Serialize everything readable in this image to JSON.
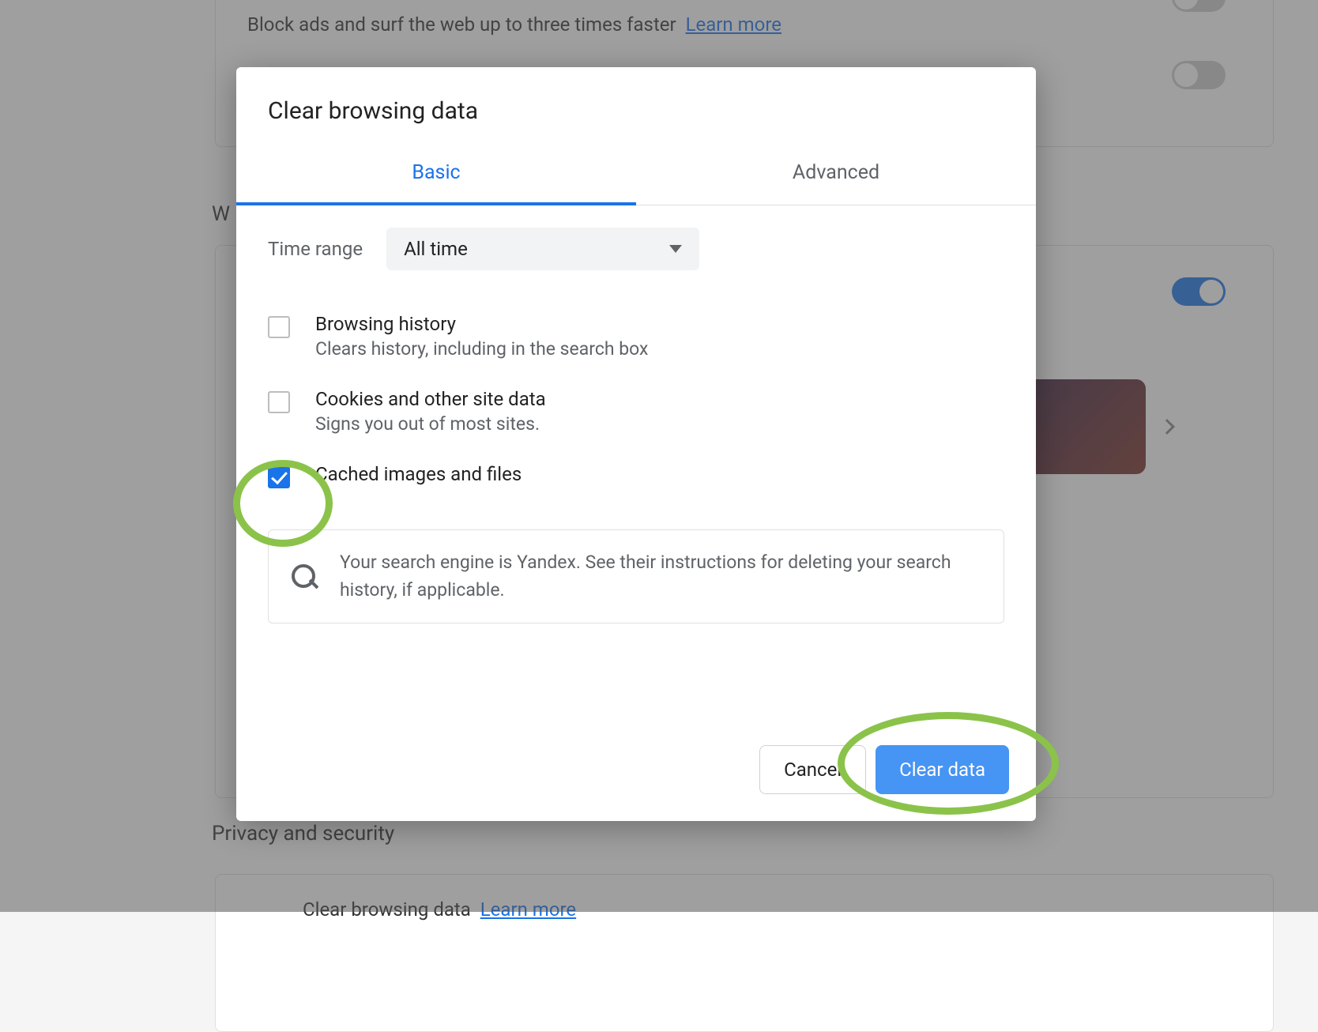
{
  "background": {
    "block_ads_text": "Block ads and surf the web up to three times faster",
    "learn_more": "Learn more",
    "section_w_prefix": "W",
    "privacy_header": "Privacy and security",
    "clear_browsing_label": "Clear browsing data",
    "clear_browsing_learn": "Learn more"
  },
  "dialog": {
    "title": "Clear browsing data",
    "tabs": {
      "basic": "Basic",
      "advanced": "Advanced"
    },
    "time_range_label": "Time range",
    "time_range_value": "All time",
    "options": {
      "history": {
        "title": "Browsing history",
        "desc": "Clears history, including in the search box"
      },
      "cookies": {
        "title": "Cookies and other site data",
        "desc": "Signs you out of most sites."
      },
      "cache": {
        "title": "Cached images and files"
      }
    },
    "info": "Your search engine is Yandex. See their instructions for deleting your search history, if applicable.",
    "cancel": "Cancel",
    "clear": "Clear data"
  }
}
